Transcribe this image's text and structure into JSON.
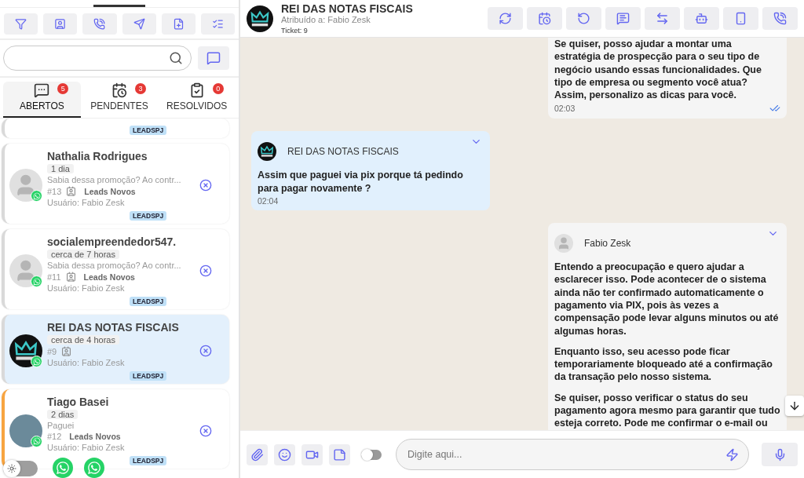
{
  "toolbar": {
    "buttons": [
      {
        "kind": "filter"
      },
      {
        "kind": "contact"
      },
      {
        "kind": "call"
      },
      {
        "kind": "send"
      },
      {
        "kind": "note"
      },
      {
        "kind": "checklist"
      }
    ]
  },
  "search": {
    "kind": "pill"
  },
  "tabs": [
    {
      "label": "ABERTOS",
      "count": "5",
      "kind": "chat",
      "selected": true
    },
    {
      "label": "PENDENTES",
      "count": "3",
      "kind": "pending",
      "selected": false
    },
    {
      "label": "RESOLVIDOS",
      "count": "0",
      "kind": "resolved",
      "selected": false
    }
  ],
  "tickets": [
    {
      "partial": true,
      "tag": "LEADSPJ",
      "color": "#d9d9d9",
      "selected": false
    },
    {
      "name": "Nathalia Rodrigues",
      "time": "1 dia",
      "preview": "Sabia dessa promoção? Ao contr...",
      "number": "#13",
      "contact_icon": true,
      "queue": "Leads Novos",
      "user": "Usuário: Fabio Zesk",
      "tag": "LEADSPJ",
      "avatar": {
        "kind": "default"
      },
      "color": "#d9d9d9",
      "selected": false
    },
    {
      "name": "socialempreendedor547.",
      "time": "cerca de 7 horas",
      "preview": "Sabia dessa promoção? Ao contr...",
      "number": "#11",
      "contact_icon": true,
      "queue": "Leads Novos",
      "user": "Usuário: Fabio Zesk",
      "tag": "LEADSPJ",
      "avatar": {
        "kind": "default"
      },
      "color": "#d9d9d9",
      "selected": false
    },
    {
      "name": "REI DAS NOTAS FISCAIS",
      "time": "cerca de 4 horas",
      "number": "#9",
      "contact_icon": true,
      "user": "Usuário: Fabio Zesk",
      "tag": "LEADSPJ",
      "avatar": {
        "kind": "logo"
      },
      "color": "#d9d9d9",
      "selected": true
    },
    {
      "name": "Tiago Basei",
      "time": "2 dias",
      "preview": "Paguei",
      "number": "#12",
      "contact_icon": false,
      "queue": "Leads Novos",
      "user": "Usuário: Fabio Zesk",
      "tag": "LEADSPJ",
      "avatar": {
        "kind": "photo"
      },
      "color": "#f7a440",
      "selected": false
    }
  ],
  "theme_toggle": {
    "on": false
  },
  "floating_buttons": [
    {
      "kind": "whatsapp"
    },
    {
      "kind": "whatsapp"
    }
  ],
  "chat": {
    "header": {
      "title": "REI DAS NOTAS FISCAIS",
      "assigned": "Atribuído a: Fabio Zesk",
      "ticket": "Ticket: 9",
      "actions": [
        {
          "kind": "refresh"
        },
        {
          "kind": "schedule"
        },
        {
          "kind": "undo"
        },
        {
          "kind": "resolve"
        },
        {
          "kind": "transfer"
        },
        {
          "kind": "bot"
        },
        {
          "kind": "device"
        },
        {
          "kind": "call"
        }
      ]
    },
    "messages": [
      {
        "from_me": true,
        "paragraphs": [
          "Se quiser, posso ajudar a montar uma estratégia de prospecção para o seu tipo de negócio usando essas funcionalidades. Que tipo de empresa ou segmento você atua? Assim, personalizo as dicas para você."
        ],
        "time": "02:03",
        "read": true
      },
      {
        "from_me": false,
        "sender": "REI DAS NOTAS FISCAIS",
        "avatar": {
          "kind": "logo"
        },
        "paragraphs": [
          "Assim que paguei via pix porque tá pedindo para pagar novamente ?"
        ],
        "time": "02:04"
      },
      {
        "from_me": true,
        "sender": "Fabio Zesk",
        "avatar": {
          "kind": "default"
        },
        "paragraphs": [
          "Entendo a preocupação e quero ajudar a esclarecer isso. Pode acontecer de o sistema ainda não ter confirmado automaticamente o pagamento via PIX, pois às vezes a compensação pode levar alguns minutos ou até algumas horas.",
          "Enquanto isso, seu acesso pode ficar temporariamente bloqueado até a confirmação da transação pelo nosso sistema.",
          "Se quiser, posso verificar o status do seu pagamento agora mesmo para garantir que tudo esteja correto. Pode me confirmar o e-mail ou"
        ]
      }
    ],
    "composer": {
      "tools": [
        {
          "kind": "attach"
        },
        {
          "kind": "emoji"
        },
        {
          "kind": "video"
        },
        {
          "kind": "note"
        }
      ],
      "toggle": {
        "on": false
      },
      "placeholder": "Digite aqui..."
    }
  }
}
